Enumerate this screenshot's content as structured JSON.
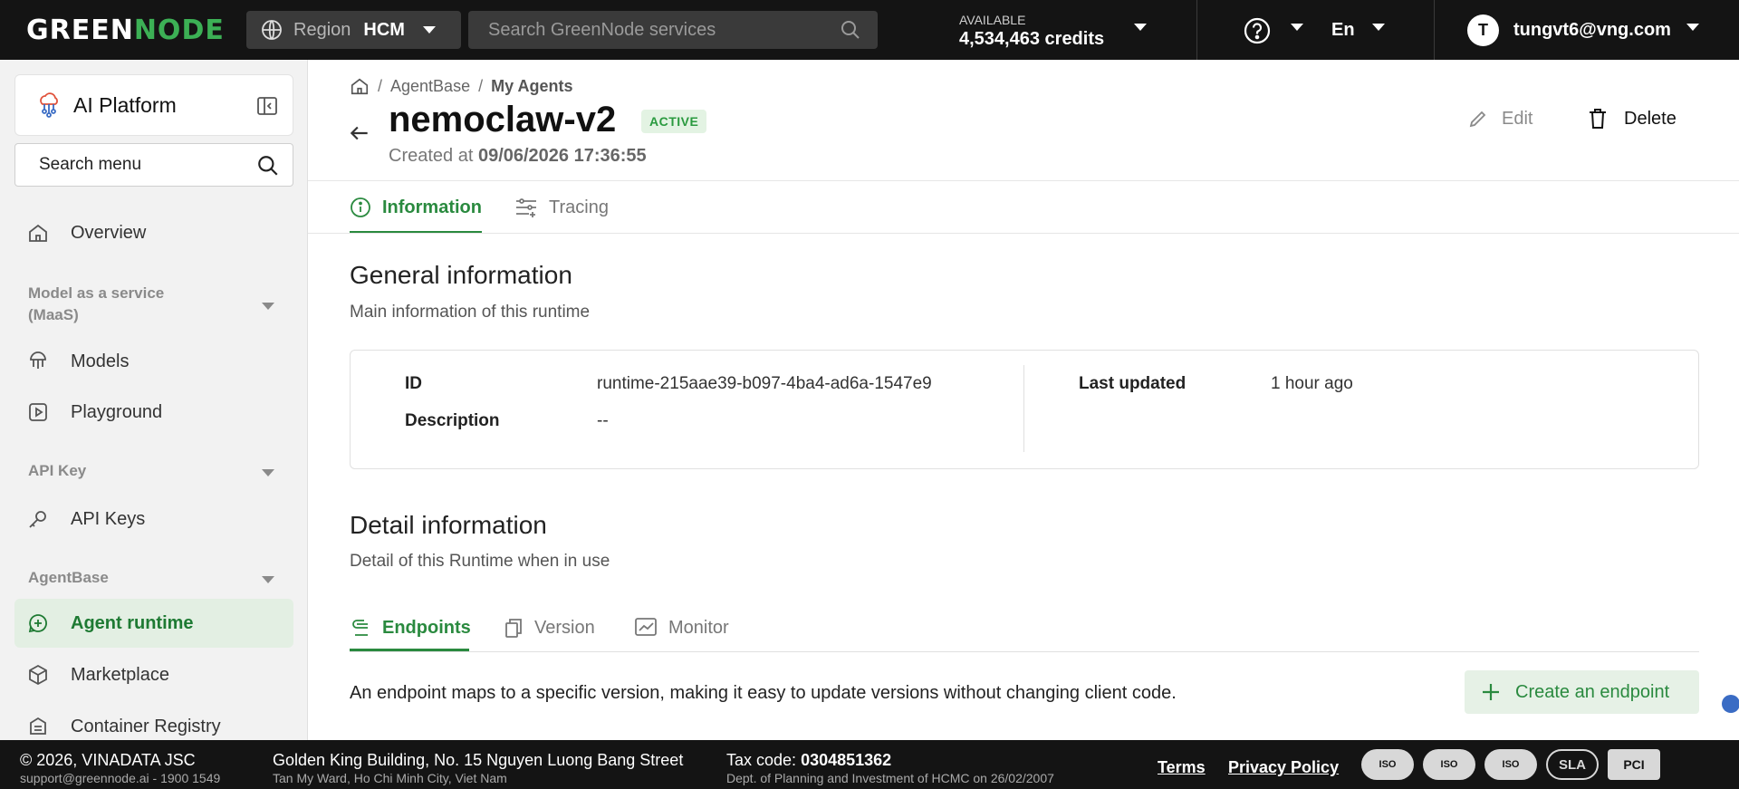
{
  "topbar": {
    "logo_left": "GREEN",
    "logo_right": "NODE",
    "region_label": "Region",
    "region_value": "HCM",
    "search_placeholder": "Search GreenNode services",
    "credits_label": "AVAILABLE",
    "credits_value": "4,534,463 credits",
    "language": "En",
    "avatar_initial": "T",
    "user_email": "tungvt6@vng.com"
  },
  "sidebar": {
    "platform_name": "AI Platform",
    "search_placeholder": "Search menu",
    "items": {
      "overview": "Overview",
      "group_maas": "Model as a service (MaaS)",
      "models": "Models",
      "playground": "Playground",
      "group_api": "API Key",
      "api_keys": "API Keys",
      "group_agentbase": "AgentBase",
      "agent_runtime": "Agent runtime",
      "marketplace": "Marketplace",
      "container_registry": "Container Registry"
    }
  },
  "main": {
    "breadcrumb": [
      "AgentBase",
      "My Agents"
    ],
    "title": "nemoclaw-v2",
    "status": "ACTIVE",
    "created_prefix": "Created at",
    "created_value": "09/06/2026 17:36:55",
    "edit_label": "Edit",
    "delete_label": "Delete",
    "tabs": {
      "information": "Information",
      "tracing": "Tracing"
    },
    "general": {
      "title": "General information",
      "subtitle": "Main information of this runtime",
      "id_label": "ID",
      "id_value": "runtime-215aae39-b097-4ba4-ad6a-1547e9",
      "description_label": "Description",
      "description_value": "--",
      "last_updated_label": "Last updated",
      "last_updated_value": "1 hour ago"
    },
    "detail": {
      "title": "Detail information",
      "subtitle": "Detail of this Runtime when in use",
      "tabs": {
        "endpoints": "Endpoints",
        "version": "Version",
        "monitor": "Monitor"
      },
      "endpoint_desc": "An endpoint maps to a specific version, making it easy to update versions without changing client code.",
      "create_button": "Create an endpoint"
    }
  },
  "footer": {
    "company": "© 2026, VINADATA JSC",
    "contact": "support@greennode.ai - 1900 1549",
    "address": "Golden King Building, No. 15 Nguyen Luong Bang Street",
    "address_sub": "Tan My Ward, Ho Chi Minh City, Viet Nam",
    "tax_prefix": "Tax code:",
    "tax_value": "0304851362",
    "tax_sub": "Dept. of Planning and Investment of HCMC on 26/02/2007",
    "terms": "Terms",
    "privacy": "Privacy Policy",
    "badges": [
      "ISO",
      "ISO",
      "ISO",
      "SLA",
      "PCI"
    ]
  },
  "colors": {
    "brand": "#3cb055",
    "accent": "#2a8a3f",
    "topbar": "#141414"
  }
}
